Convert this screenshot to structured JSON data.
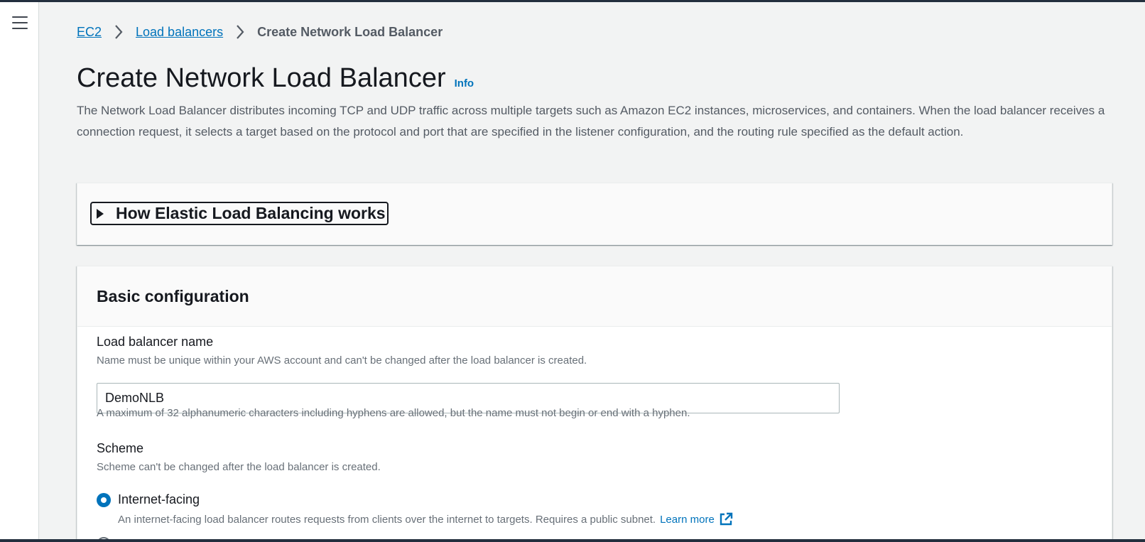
{
  "breadcrumb": {
    "items": [
      "EC2",
      "Load balancers"
    ],
    "current": "Create Network Load Balancer"
  },
  "page": {
    "title": "Create Network Load Balancer",
    "info_label": "Info",
    "description": "The Network Load Balancer distributes incoming TCP and UDP traffic across multiple targets such as Amazon EC2 instances, microservices, and containers. When the load balancer receives a connection request, it selects a target based on the protocol and port that are specified in the listener configuration, and the routing rule specified as the default action."
  },
  "expander": {
    "title": "How Elastic Load Balancing works"
  },
  "basic_config": {
    "title": "Basic configuration",
    "name_label": "Load balancer name",
    "name_description": "Name must be unique within your AWS account and can't be changed after the load balancer is created.",
    "name_value": "DemoNLB",
    "name_constraint": "A maximum of 32 alphanumeric characters including hyphens are allowed, but the name must not begin or end with a hyphen.",
    "scheme_label": "Scheme",
    "scheme_description": "Scheme can't be changed after the load balancer is created.",
    "scheme_options": [
      {
        "label": "Internet-facing",
        "selected": true,
        "description": "An internet-facing load balancer routes requests from clients over the internet to targets. Requires a public subnet.",
        "learn_more": "Learn more"
      }
    ]
  },
  "colors": {
    "link": "#0073bb",
    "page_bg": "#f2f3f3",
    "text": "#16191f",
    "secondary_text": "#687078",
    "nav_dark": "#232f3e"
  }
}
